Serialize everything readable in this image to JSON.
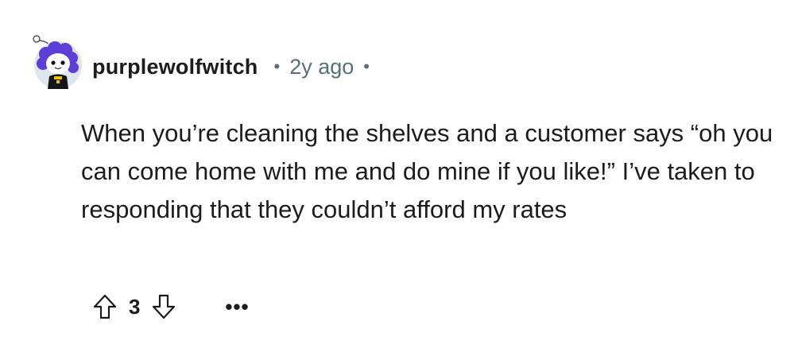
{
  "comment": {
    "author": "purplewolfwitch",
    "separator": "•",
    "time_ago": "2y ago",
    "trailing_separator": "•",
    "body": "When you’re cleaning the shelves and a customer says “oh you can come home with me and do mine if you like!” I’ve taken to responding that they couldn’t afford my rates",
    "score": "3",
    "more_label": "•••"
  },
  "icons": {
    "avatar": "snoo-avatar-icon",
    "upvote": "arrow-up-icon",
    "downvote": "arrow-down-icon",
    "more": "ellipsis-icon"
  },
  "colors": {
    "text": "#1c1c1c",
    "meta": "#576f76",
    "avatar_hair": "#5b3fd6",
    "avatar_bg": "#dde6ec"
  }
}
